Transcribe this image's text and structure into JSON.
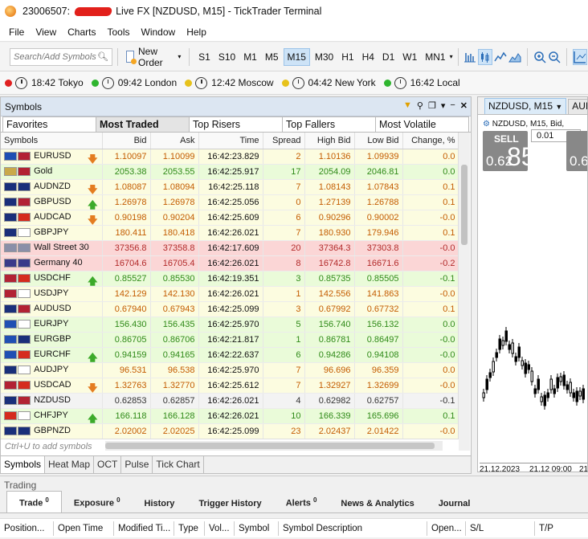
{
  "window": {
    "account": "23006507:",
    "title_rest": "Live FX [NZDUSD, M15] - TickTrader Terminal"
  },
  "menu": [
    "File",
    "View",
    "Charts",
    "Tools",
    "Window",
    "Help"
  ],
  "toolbar": {
    "search_placeholder": "Search/Add Symbols",
    "new_order": "New Order",
    "timeframes": [
      "S1",
      "S10",
      "M1",
      "M5",
      "M15",
      "M30",
      "H1",
      "H4",
      "D1",
      "W1",
      "MN1"
    ],
    "active_timeframe": "M15"
  },
  "clocks": [
    {
      "time": "18:42",
      "city": "Tokyo",
      "dot": "#e02020"
    },
    {
      "time": "09:42",
      "city": "London",
      "dot": "#2fb52f"
    },
    {
      "time": "12:42",
      "city": "Moscow",
      "dot": "#e7c21b"
    },
    {
      "time": "04:42",
      "city": "New York",
      "dot": "#e7c21b"
    },
    {
      "time": "16:42",
      "city": "Local",
      "dot": "#2fb52f"
    }
  ],
  "symbols_panel": {
    "title": "Symbols",
    "tabs": [
      "Favorites",
      "Most Traded",
      "Top Risers",
      "Top Fallers",
      "Most Volatile"
    ],
    "active_tab": "Most Traded",
    "columns": [
      "Symbols",
      "Bid",
      "Ask",
      "Time",
      "Spread",
      "High Bid",
      "Low Bid",
      "Change, %"
    ],
    "rows": [
      {
        "symbol": "EURUSD",
        "bid": "1.10097",
        "ask": "1.10099",
        "time": "16:42:23.829",
        "spread": "2",
        "high": "1.10136",
        "low": "1.09939",
        "change": "0.0",
        "color": "yellow",
        "arrow": "down",
        "flags": [
          "#1f4fb3",
          "#b22234"
        ]
      },
      {
        "symbol": "Gold",
        "bid": "2053.38",
        "ask": "2053.55",
        "time": "16:42:25.917",
        "spread": "17",
        "high": "2054.09",
        "low": "2046.81",
        "change": "0.0",
        "color": "green",
        "arrow": "",
        "flags": [
          "#c9a94a",
          "#b22234"
        ]
      },
      {
        "symbol": "AUDNZD",
        "bid": "1.08087",
        "ask": "1.08094",
        "time": "16:42:25.118",
        "spread": "7",
        "high": "1.08143",
        "low": "1.07843",
        "change": "0.1",
        "color": "yellow",
        "arrow": "down",
        "flags": [
          "#1a2f7a",
          "#1a2f7a"
        ]
      },
      {
        "symbol": "GBPUSD",
        "bid": "1.26978",
        "ask": "1.26978",
        "time": "16:42:25.056",
        "spread": "0",
        "high": "1.27139",
        "low": "1.26788",
        "change": "0.1",
        "color": "yellow",
        "arrow": "up",
        "flags": [
          "#1a2f7a",
          "#b22234"
        ]
      },
      {
        "symbol": "AUDCAD",
        "bid": "0.90198",
        "ask": "0.90204",
        "time": "16:42:25.609",
        "spread": "6",
        "high": "0.90296",
        "low": "0.90002",
        "change": "-0.0",
        "color": "yellow",
        "arrow": "down",
        "flags": [
          "#1a2f7a",
          "#d52b1e"
        ]
      },
      {
        "symbol": "GBPJPY",
        "bid": "180.411",
        "ask": "180.418",
        "time": "16:42:26.021",
        "spread": "7",
        "high": "180.930",
        "low": "179.946",
        "change": "0.1",
        "color": "yellow",
        "arrow": "",
        "flags": [
          "#1a2f7a",
          "#ffffff"
        ]
      },
      {
        "symbol": "Wall Street 30",
        "bid": "37356.8",
        "ask": "37358.8",
        "time": "16:42:17.609",
        "spread": "20",
        "high": "37364.3",
        "low": "37303.8",
        "change": "-0.0",
        "color": "red",
        "arrow": "",
        "flags": [
          "#8a8fa8",
          "#8a8fa8"
        ]
      },
      {
        "symbol": "Germany 40",
        "bid": "16704.6",
        "ask": "16705.4",
        "time": "16:42:26.021",
        "spread": "8",
        "high": "16742.8",
        "low": "16671.6",
        "change": "-0.2",
        "color": "red",
        "arrow": "",
        "flags": [
          "#3a3a8a",
          "#3a3a8a"
        ]
      },
      {
        "symbol": "USDCHF",
        "bid": "0.85527",
        "ask": "0.85530",
        "time": "16:42:19.351",
        "spread": "3",
        "high": "0.85735",
        "low": "0.85505",
        "change": "-0.1",
        "color": "green",
        "arrow": "up",
        "flags": [
          "#b22234",
          "#d52b1e"
        ]
      },
      {
        "symbol": "USDJPY",
        "bid": "142.129",
        "ask": "142.130",
        "time": "16:42:26.021",
        "spread": "1",
        "high": "142.556",
        "low": "141.863",
        "change": "-0.0",
        "color": "yellow",
        "arrow": "",
        "flags": [
          "#b22234",
          "#ffffff"
        ]
      },
      {
        "symbol": "AUDUSD",
        "bid": "0.67940",
        "ask": "0.67943",
        "time": "16:42:25.099",
        "spread": "3",
        "high": "0.67992",
        "low": "0.67732",
        "change": "0.1",
        "color": "yellow",
        "arrow": "",
        "flags": [
          "#1a2f7a",
          "#b22234"
        ]
      },
      {
        "symbol": "EURJPY",
        "bid": "156.430",
        "ask": "156.435",
        "time": "16:42:25.970",
        "spread": "5",
        "high": "156.740",
        "low": "156.132",
        "change": "0.0",
        "color": "green",
        "arrow": "",
        "flags": [
          "#1f4fb3",
          "#ffffff"
        ]
      },
      {
        "symbol": "EURGBP",
        "bid": "0.86705",
        "ask": "0.86706",
        "time": "16:42:21.817",
        "spread": "1",
        "high": "0.86781",
        "low": "0.86497",
        "change": "-0.0",
        "color": "green",
        "arrow": "",
        "flags": [
          "#1f4fb3",
          "#1a2f7a"
        ]
      },
      {
        "symbol": "EURCHF",
        "bid": "0.94159",
        "ask": "0.94165",
        "time": "16:42:22.637",
        "spread": "6",
        "high": "0.94286",
        "low": "0.94108",
        "change": "-0.0",
        "color": "green",
        "arrow": "up",
        "flags": [
          "#1f4fb3",
          "#d52b1e"
        ]
      },
      {
        "symbol": "AUDJPY",
        "bid": "96.531",
        "ask": "96.538",
        "time": "16:42:25.970",
        "spread": "7",
        "high": "96.696",
        "low": "96.359",
        "change": "0.0",
        "color": "yellow",
        "arrow": "",
        "flags": [
          "#1a2f7a",
          "#ffffff"
        ]
      },
      {
        "symbol": "USDCAD",
        "bid": "1.32763",
        "ask": "1.32770",
        "time": "16:42:25.612",
        "spread": "7",
        "high": "1.32927",
        "low": "1.32699",
        "change": "-0.0",
        "color": "yellow",
        "arrow": "down",
        "flags": [
          "#b22234",
          "#d52b1e"
        ]
      },
      {
        "symbol": "NZDUSD",
        "bid": "0.62853",
        "ask": "0.62857",
        "time": "16:42:26.021",
        "spread": "4",
        "high": "0.62982",
        "low": "0.62757",
        "change": "-0.1",
        "color": "gray",
        "arrow": "",
        "flags": [
          "#1a2f7a",
          "#b22234"
        ]
      },
      {
        "symbol": "CHFJPY",
        "bid": "166.118",
        "ask": "166.128",
        "time": "16:42:26.021",
        "spread": "10",
        "high": "166.339",
        "low": "165.696",
        "change": "0.1",
        "color": "green",
        "arrow": "up",
        "flags": [
          "#d52b1e",
          "#ffffff"
        ]
      },
      {
        "symbol": "GBPNZD",
        "bid": "2.02002",
        "ask": "2.02025",
        "time": "16:42:25.099",
        "spread": "23",
        "high": "2.02437",
        "low": "2.01422",
        "change": "-0.0",
        "color": "yellow",
        "arrow": "",
        "flags": [
          "#1a2f7a",
          "#1a2f7a"
        ]
      }
    ],
    "add_hint": "Ctrl+U to add symbols",
    "bottom_tabs": [
      "Symbols",
      "Heat Map",
      "OCT",
      "Pulse",
      "Tick Chart"
    ],
    "active_bottom_tab": "Symbols"
  },
  "chart_panel": {
    "tab": "NZDUSD, M15",
    "tab2": "AUD",
    "info": "NZDUSD, M15, Bid, ",
    "sell_label": "SELL",
    "sell_small": "0.62",
    "sell_big": "85",
    "sell_sup": "3",
    "buy_small": "0.6",
    "lot": "0.01",
    "dates": [
      "21.12.2023",
      "21.12 09:00",
      "21"
    ]
  },
  "trading": {
    "title": "Trading",
    "tabs": [
      {
        "label": "Trade",
        "count": "0"
      },
      {
        "label": "Exposure",
        "count": "0"
      },
      {
        "label": "History",
        "count": ""
      },
      {
        "label": "Trigger History",
        "count": ""
      },
      {
        "label": "Alerts",
        "count": "0"
      },
      {
        "label": "News & Analytics",
        "count": ""
      },
      {
        "label": "Journal",
        "count": ""
      }
    ],
    "columns": [
      "Position...",
      "Open Time",
      "Modified Ti...",
      "Type",
      "Vol...",
      "Symbol",
      "Symbol Description",
      "Open...",
      "S/L",
      "T/P"
    ]
  }
}
